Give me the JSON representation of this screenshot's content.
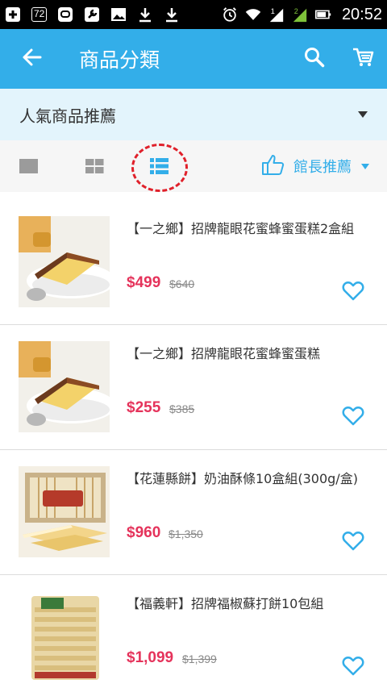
{
  "status_bar": {
    "battery_badge": "72",
    "time": "20:52",
    "icons": [
      "plus-icon",
      "battery-72-badge",
      "chat-app-icon",
      "tools-app-icon",
      "image-icon",
      "download-icon",
      "download-icon",
      "alarm-icon",
      "wifi-icon",
      "signal-1-icon",
      "signal-2-icon",
      "battery-icon"
    ]
  },
  "app_bar": {
    "title": "商品分類",
    "icons": [
      "back-arrow-icon",
      "search-icon",
      "cart-icon"
    ],
    "background": "#33aee9"
  },
  "category": {
    "label": "人氣商品推薦",
    "icon": "caret-down-icon"
  },
  "view_bar": {
    "modes": [
      "single-view-icon",
      "grid-view-icon",
      "list-view-icon"
    ],
    "active_mode": "list",
    "sort_label": "館長推薦",
    "sort_icon": "thumbs-up-icon",
    "highlight_color": "#e0202a"
  },
  "products": [
    {
      "name": "【一之鄉】招牌龍眼花蜜蜂蜜蛋糕2盒組",
      "price": "$499",
      "original_price": "$640",
      "image": "honey-cake",
      "favorite_icon": "heart-outline-icon"
    },
    {
      "name": "【一之鄉】招牌龍眼花蜜蜂蜜蛋糕",
      "price": "$255",
      "original_price": "$385",
      "image": "honey-cake",
      "favorite_icon": "heart-outline-icon"
    },
    {
      "name": "【花蓮縣餅】奶油酥條10盒組(300g/盒)",
      "price": "$960",
      "original_price": "$1,350",
      "image": "butter-sticks",
      "favorite_icon": "heart-outline-icon"
    },
    {
      "name": "【福義軒】招牌福椒蘇打餅10包組",
      "price": "$1,099",
      "original_price": "$1,399",
      "image": "soda-crackers",
      "favorite_icon": "heart-outline-icon"
    }
  ],
  "colors": {
    "accent": "#33aee9",
    "price": "#e5335b",
    "category_bg": "#e3f4fc"
  }
}
